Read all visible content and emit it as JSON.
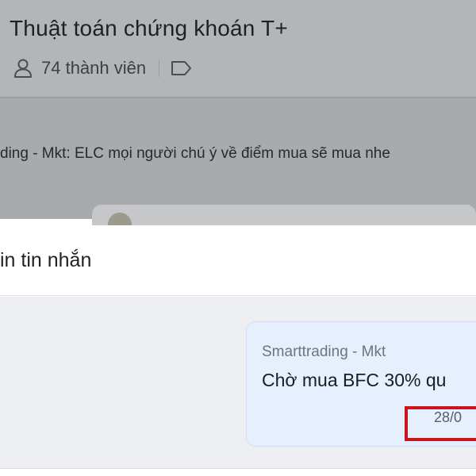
{
  "group": {
    "title": "Thuật toán chứng khoán T+",
    "member_count": "74 thành viên",
    "icons": {
      "members": "person-icon",
      "tag": "tag-icon"
    }
  },
  "pinned_message": {
    "text": "ding - Mkt: ELC mọi người chú ý về điểm mua sẽ mua nhe"
  },
  "modal": {
    "title": "in tin nhắn",
    "message": {
      "sender": "Smarttrading - Mkt",
      "text": "Chờ mua BFC 30% qu",
      "date": "28/0"
    }
  },
  "colors": {
    "overlay": "#b4b5b8",
    "bubble": "#e5effd",
    "highlight": "#c9151c"
  }
}
